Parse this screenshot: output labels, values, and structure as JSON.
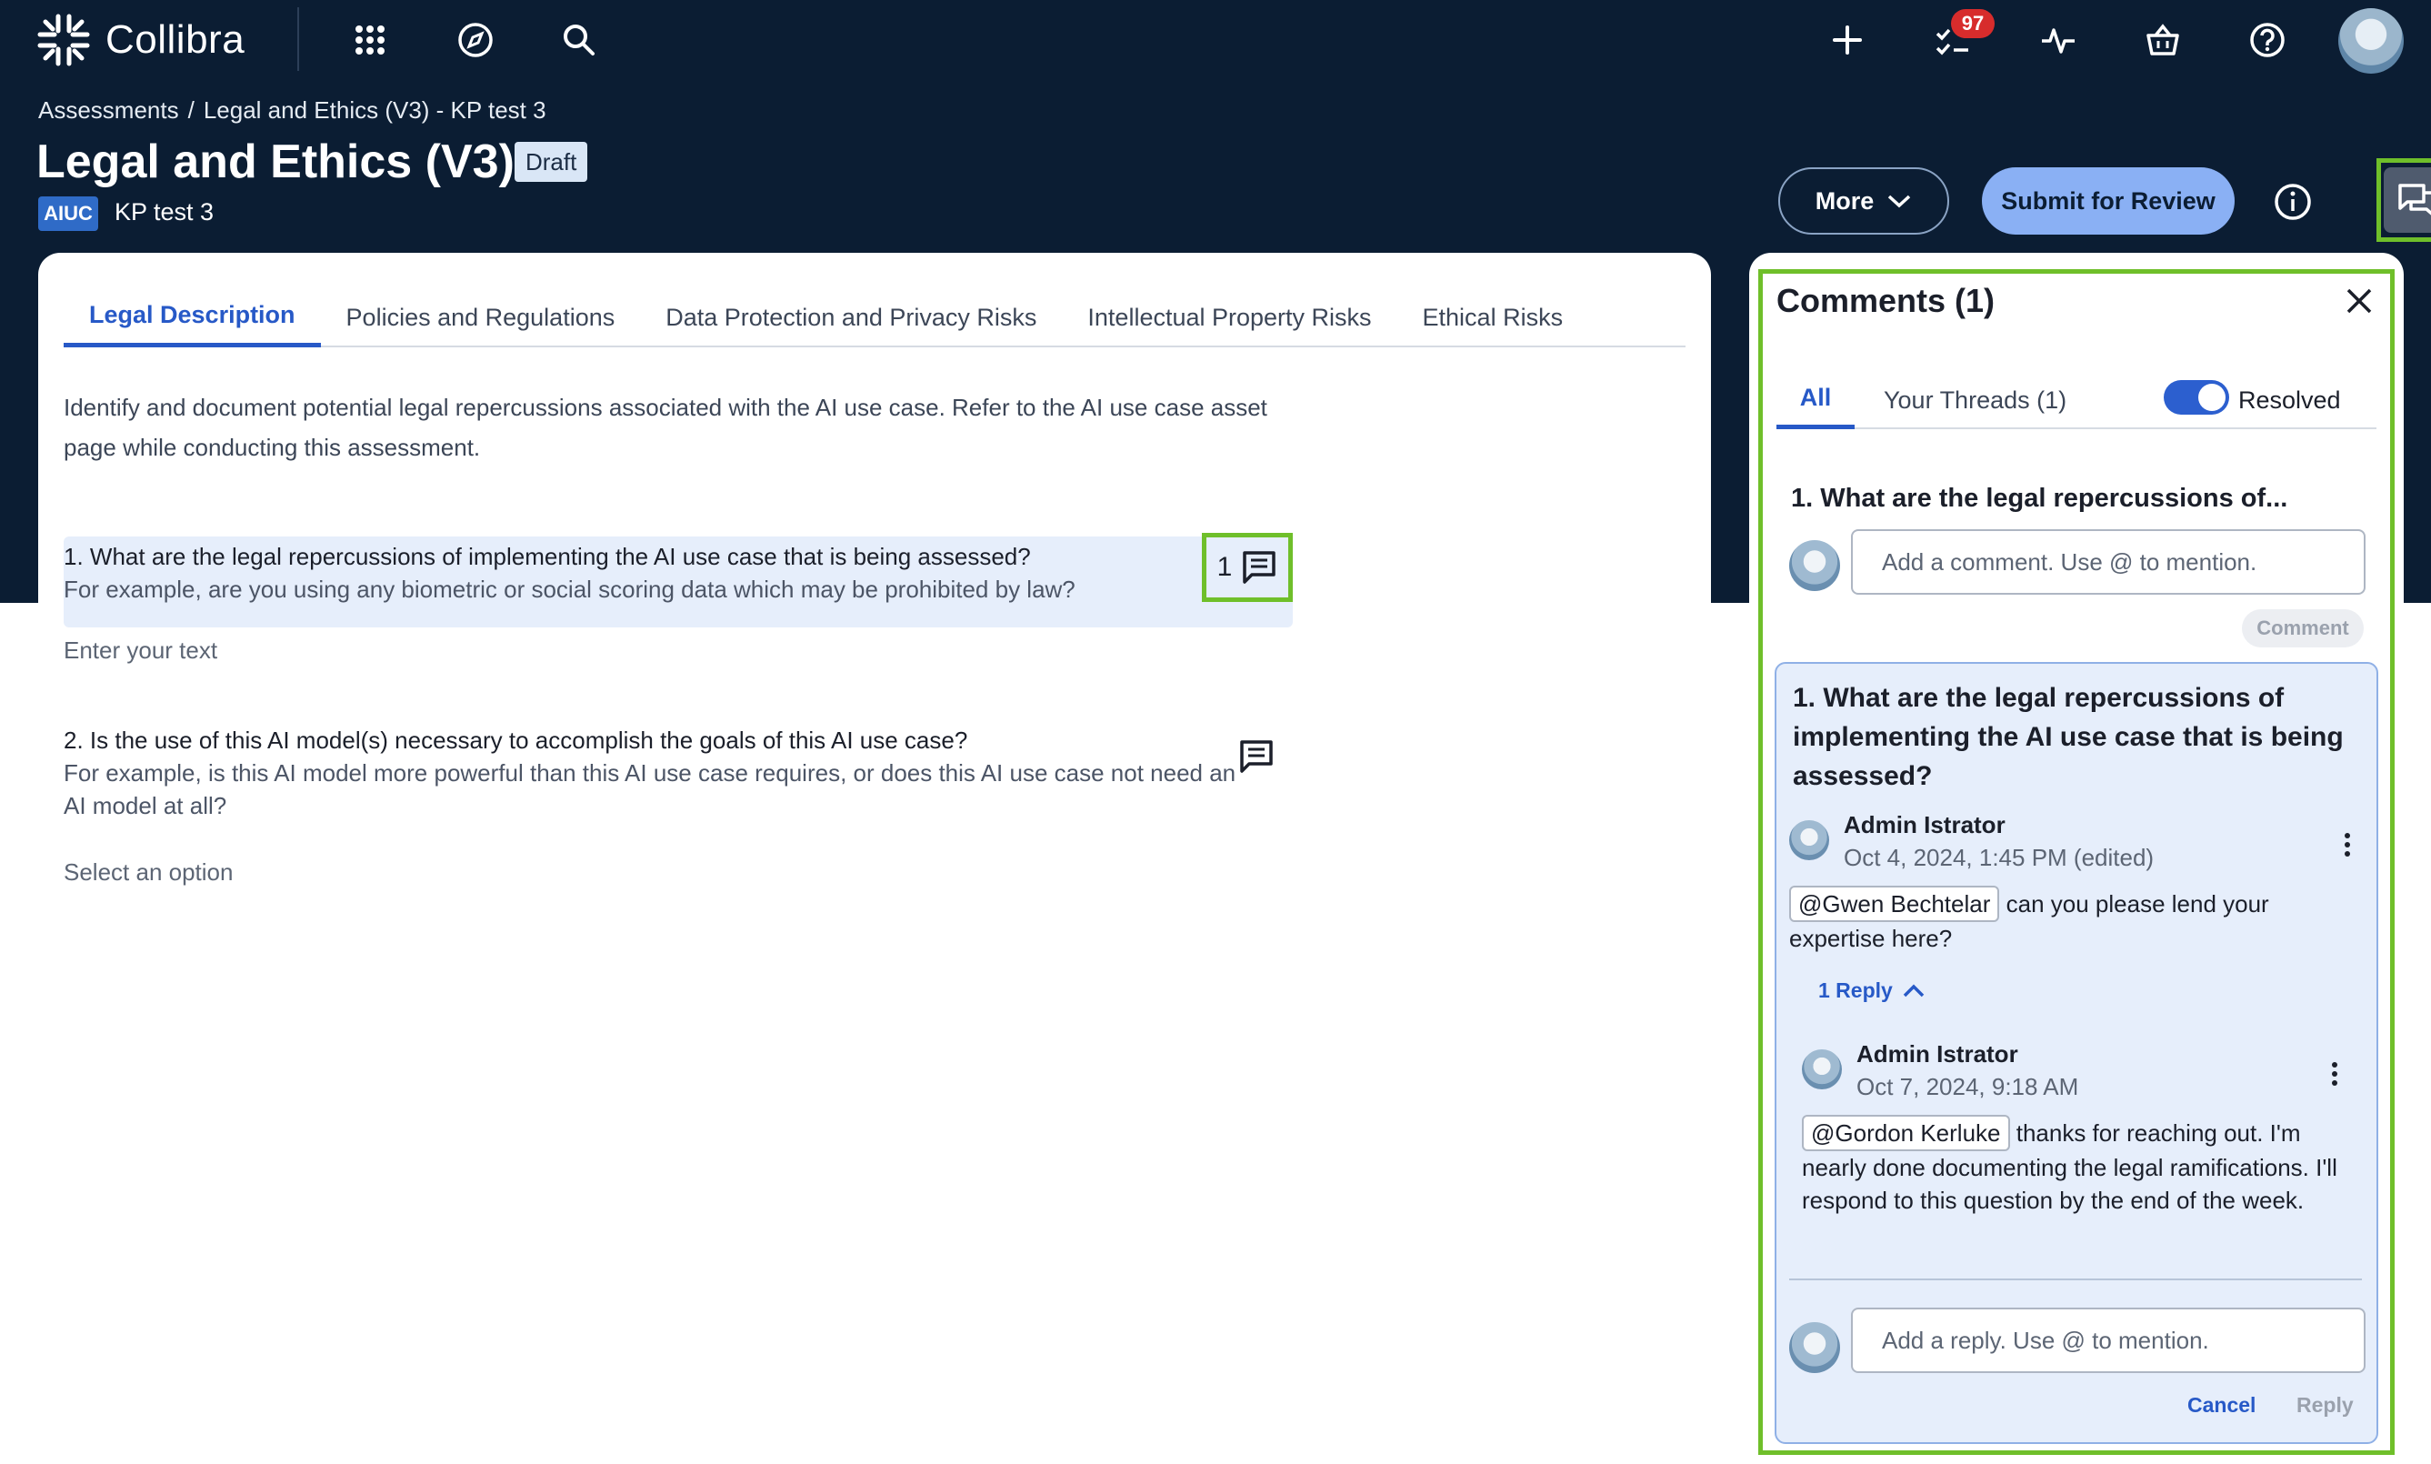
{
  "app": {
    "name": "Collibra"
  },
  "topnav": {
    "task_count": "97"
  },
  "breadcrumb": {
    "root": "Assessments",
    "separator": "/",
    "current": "Legal and Ethics (V3) - KP test 3"
  },
  "page": {
    "title": "Legal and Ethics (V3)",
    "status": "Draft",
    "asset_type": "AIUC",
    "asset_name": "KP test 3",
    "more_label": "More",
    "submit_label": "Submit for Review"
  },
  "tabs": [
    {
      "label": "Legal Description",
      "active": true
    },
    {
      "label": "Policies and Regulations",
      "active": false
    },
    {
      "label": "Data Protection and Privacy Risks",
      "active": false
    },
    {
      "label": "Intellectual Property Risks",
      "active": false
    },
    {
      "label": "Ethical Risks",
      "active": false
    }
  ],
  "description": "Identify and document potential legal repercussions associated with the AI use case. Refer to the AI use case asset page while conducting this assessment.",
  "questions": [
    {
      "title": "1. What are the legal repercussions of implementing the AI use case that is being assessed?",
      "help": "For example, are you using any biometric or social scoring data which may be prohibited by law?",
      "comment_count": "1",
      "placeholder": "Enter your text"
    },
    {
      "title": "2. Is the use of this AI model(s) necessary to accomplish the goals of this AI use case?",
      "help": "For example, is this AI model more powerful than this AI use case requires, or does this AI use case not need an AI model at all?",
      "placeholder": "Select an option"
    }
  ],
  "comments": {
    "title": "Comments (1)",
    "tabs": {
      "all": "All",
      "yours": "Your Threads (1)"
    },
    "resolved_label": "Resolved",
    "resolved_on": true,
    "question_heading": "1. What are the legal repercussions of...",
    "new_comment_placeholder": "Add a comment. Use @ to mention.",
    "comment_button": "Comment",
    "thread": {
      "question": "1. What are the legal repercussions of implementing the AI use case that is being assessed?",
      "first": {
        "author": "Admin Istrator",
        "timestamp": "Oct 4, 2024, 1:45 PM (edited)",
        "mention": "@Gwen Bechtelar",
        "body": "can you please lend your expertise here?"
      },
      "reply_toggle": "1 Reply",
      "reply": {
        "author": "Admin Istrator",
        "timestamp": "Oct 7, 2024, 9:18 AM",
        "mention": "@Gordon Kerluke",
        "body": "thanks for reaching out. I'm nearly done documenting the legal ramifications. I'll respond to this question by the end of the week."
      },
      "reply_placeholder": "Add a reply. Use @ to mention.",
      "cancel_label": "Cancel",
      "reply_label": "Reply"
    }
  },
  "colors": {
    "header_bg": "#0b1d33",
    "accent": "#2759c7",
    "submit_bg": "#8ab0f4",
    "highlight_outline": "#6fbf2a",
    "badge_red": "#d72c2c"
  }
}
